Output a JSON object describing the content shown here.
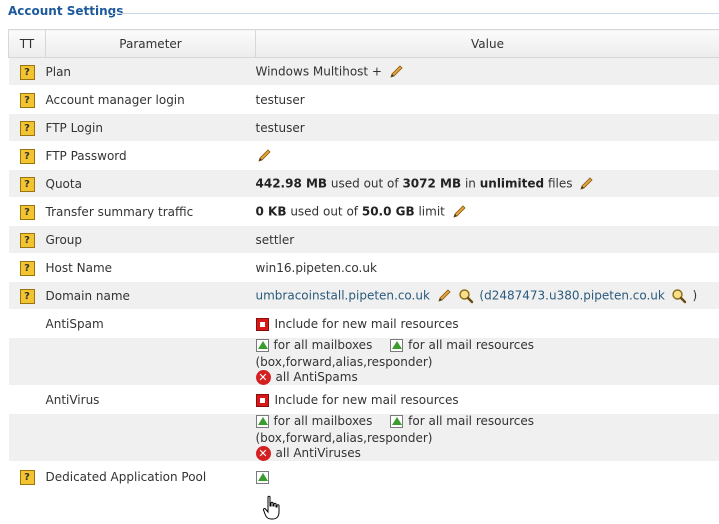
{
  "section": {
    "title": "Account Settings"
  },
  "columns": {
    "tt": "TT",
    "parameter": "Parameter",
    "value": "Value"
  },
  "rows": {
    "plan": {
      "label": "Plan",
      "value": "Windows Multihost +"
    },
    "manager": {
      "label": "Account manager login",
      "value": "testuser"
    },
    "ftp_login": {
      "label": "FTP Login",
      "value": "testuser"
    },
    "ftp_password": {
      "label": "FTP Password"
    },
    "quota": {
      "label": "Quota",
      "used": "442.98 MB",
      "t1": "used out of",
      "total": "3072 MB",
      "t2": "in",
      "files": "unlimited",
      "t3": "files"
    },
    "transfer": {
      "label": "Transfer summary traffic",
      "used": "0 KB",
      "t1": "used out of",
      "limit": "50.0 GB",
      "t2": "limit"
    },
    "group": {
      "label": "Group",
      "value": "settler"
    },
    "hostname": {
      "label": "Host Name",
      "value": "win16.pipeten.co.uk"
    },
    "domain": {
      "label": "Domain name",
      "value": "umbracoinstall.pipeten.co.uk",
      "alias_open": "(d2487473.u380.pipeten.co.uk",
      "alias_close": ")"
    },
    "antispam": {
      "label": "AntiSpam",
      "include": "Include for new mail resources",
      "mailboxes": "for all mailboxes",
      "mail_resources": "for all mail resources",
      "types": "(box,forward,alias,responder)",
      "remove_all": "all AntiSpams"
    },
    "antivirus": {
      "label": "AntiVirus",
      "include": "Include for new mail resources",
      "mailboxes": "for all mailboxes",
      "mail_resources": "for all mail resources",
      "types": "(box,forward,alias,responder)",
      "remove_all": "all AntiViruses"
    },
    "app_pool": {
      "label": "Dedicated Application Pool"
    }
  },
  "help_glyph": "?",
  "delete_glyph": "✕",
  "colors": {
    "title": "#1c5a9c",
    "help": "#f4c430",
    "stop": "#d81818",
    "arrow": "#3b9c2e"
  }
}
